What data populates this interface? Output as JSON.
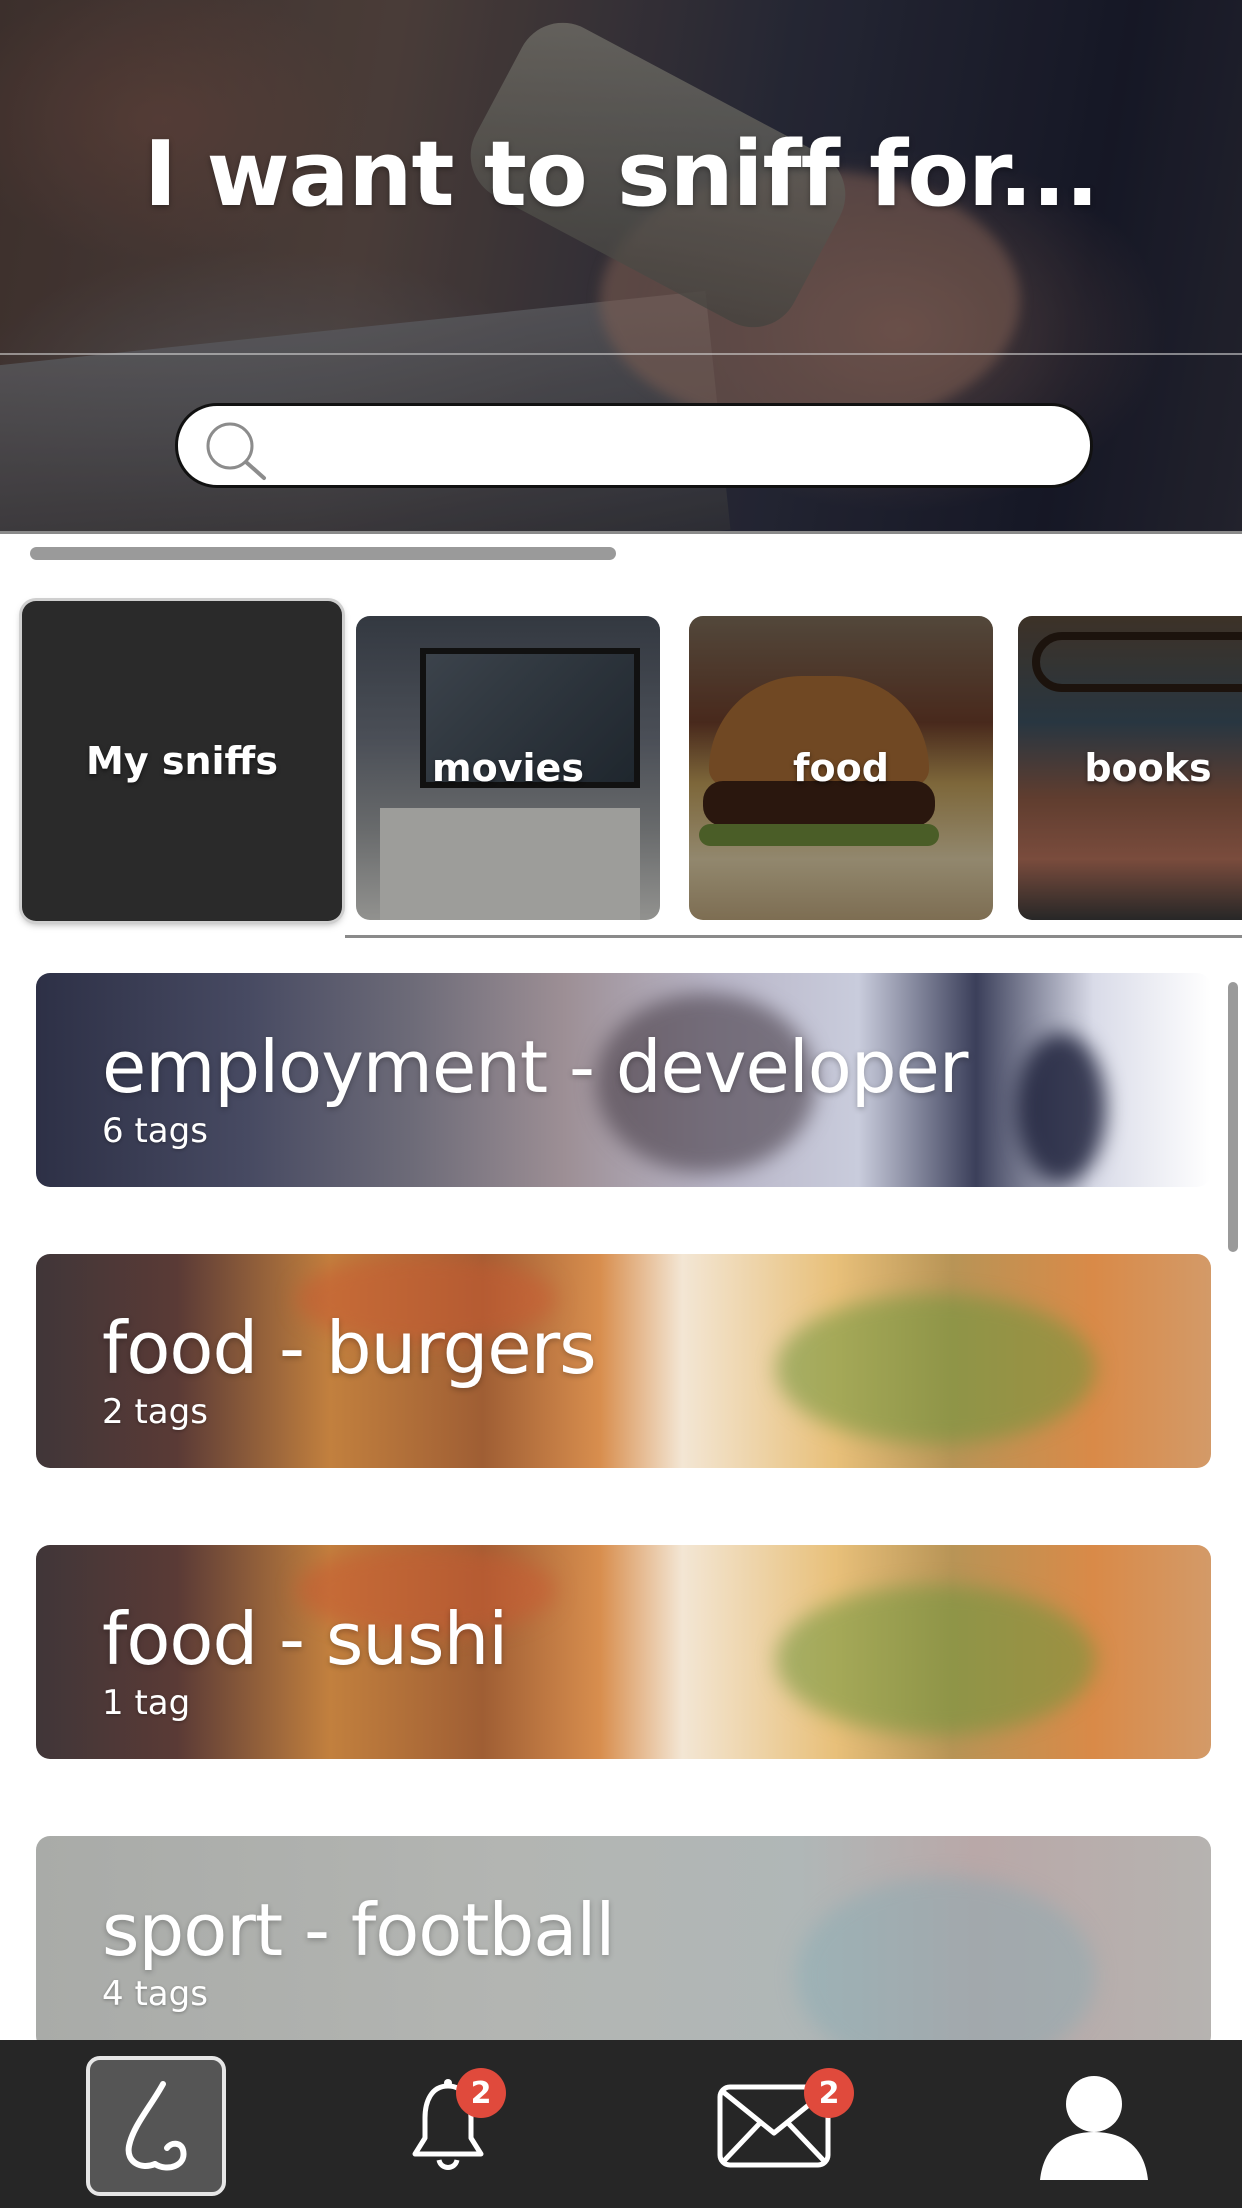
{
  "header": {
    "title": "I want to sniff for...",
    "search": {
      "value": "",
      "placeholder": ""
    }
  },
  "categories": [
    {
      "label": "My sniffs",
      "selected": true
    },
    {
      "label": "movies"
    },
    {
      "label": "food"
    },
    {
      "label": "books"
    }
  ],
  "sniffs": [
    {
      "title": "employment - developer",
      "tags": "6 tags"
    },
    {
      "title": "food - burgers",
      "tags": "2 tags"
    },
    {
      "title": "food - sushi",
      "tags": "1 tag"
    },
    {
      "title": "sport - football",
      "tags": "4 tags"
    }
  ],
  "bottom_nav": {
    "items": [
      {
        "icon": "nose-icon",
        "active": true
      },
      {
        "icon": "bell-icon",
        "badge": "2"
      },
      {
        "icon": "envelope-icon",
        "badge": "2"
      },
      {
        "icon": "profile-icon"
      }
    ]
  },
  "colors": {
    "nav_background": "#262626",
    "badge": "#e04a3c",
    "tile_dark": "#2a2a2a"
  }
}
